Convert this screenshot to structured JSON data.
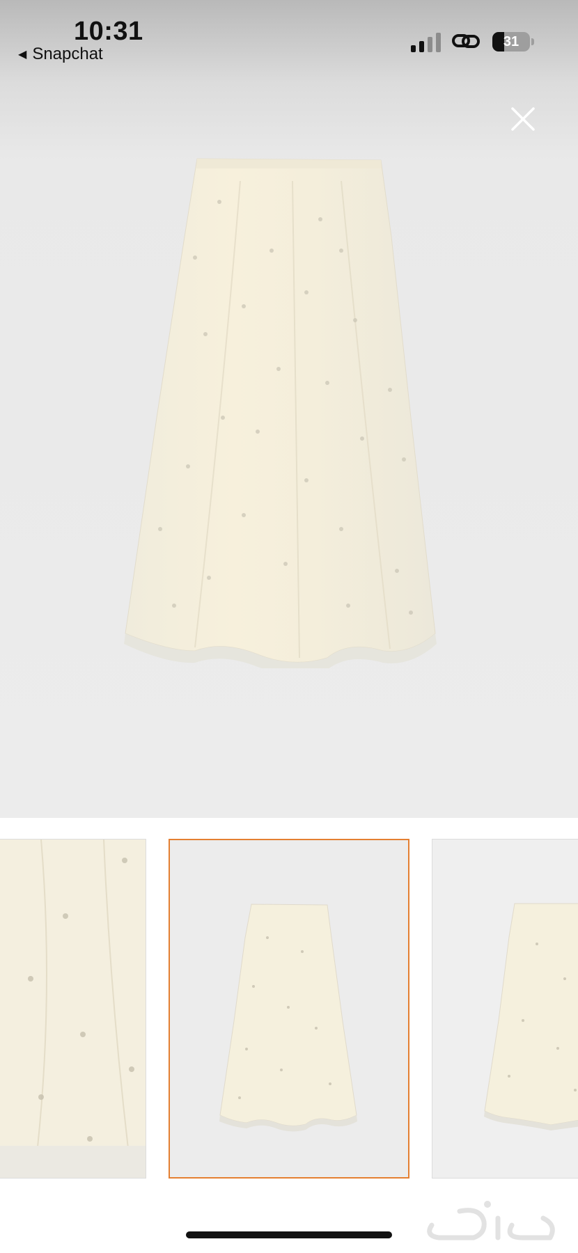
{
  "status_bar": {
    "time": "10:31",
    "back_app_label": "Snapchat",
    "battery_level": "31",
    "battery_fraction": 0.31
  },
  "viewer": {
    "close_icon": "close-icon",
    "main_image": "cream-embroidered-midi-skirt"
  },
  "thumbnails": [
    {
      "name": "skirt-closeup-detail",
      "selected": false
    },
    {
      "name": "cream-embroidered-midi-skirt",
      "selected": true
    },
    {
      "name": "cream-embroidered-midi-skirt-alt",
      "selected": false
    }
  ],
  "colors": {
    "selected_border": "#e47f31",
    "fabric": "#f4efdd",
    "background": "#ececec"
  },
  "watermark_icon": "haraj-logo"
}
